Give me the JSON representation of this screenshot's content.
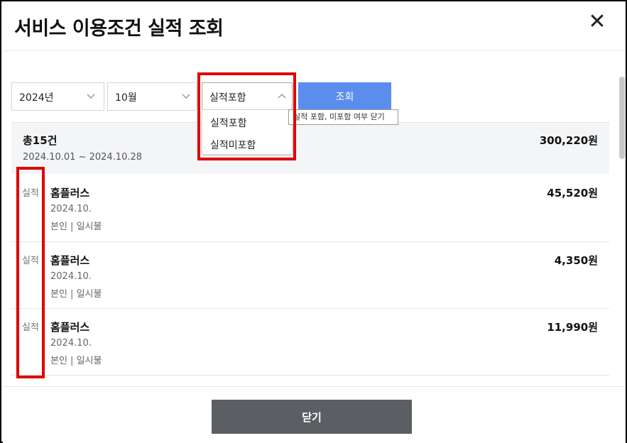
{
  "dialog": {
    "title": "서비스 이용조건 실적 조회",
    "close_icon": "close-icon"
  },
  "filters": {
    "year": "2024년",
    "month": "10월",
    "performance": "실적포함",
    "search_label": "조회",
    "dropdown_options": [
      "실적포함",
      "실적미포함"
    ],
    "tooltip": "실적 포함, 미포함 여부 닫기"
  },
  "summary": {
    "count": "총15건",
    "range": "2024.10.01 ~ 2024.10.28",
    "total": "300,220원"
  },
  "rows": [
    {
      "tag": "실적",
      "name": "홈플러스",
      "date": "2024.10.",
      "desc": "본인 |  일시불",
      "amount": "45,520원"
    },
    {
      "tag": "실적",
      "name": "홈플러스",
      "date": "2024.10.",
      "desc": "본인 |  일시불",
      "amount": "4,350원"
    },
    {
      "tag": "실적",
      "name": "홈플러스",
      "date": "2024.10.",
      "desc": "본인 |  일시불",
      "amount": "11,990원"
    }
  ],
  "footer": {
    "close_label": "닫기"
  },
  "colors": {
    "accent": "#5b8def",
    "highlight": "#e00000",
    "close_button": "#5b5e63"
  }
}
